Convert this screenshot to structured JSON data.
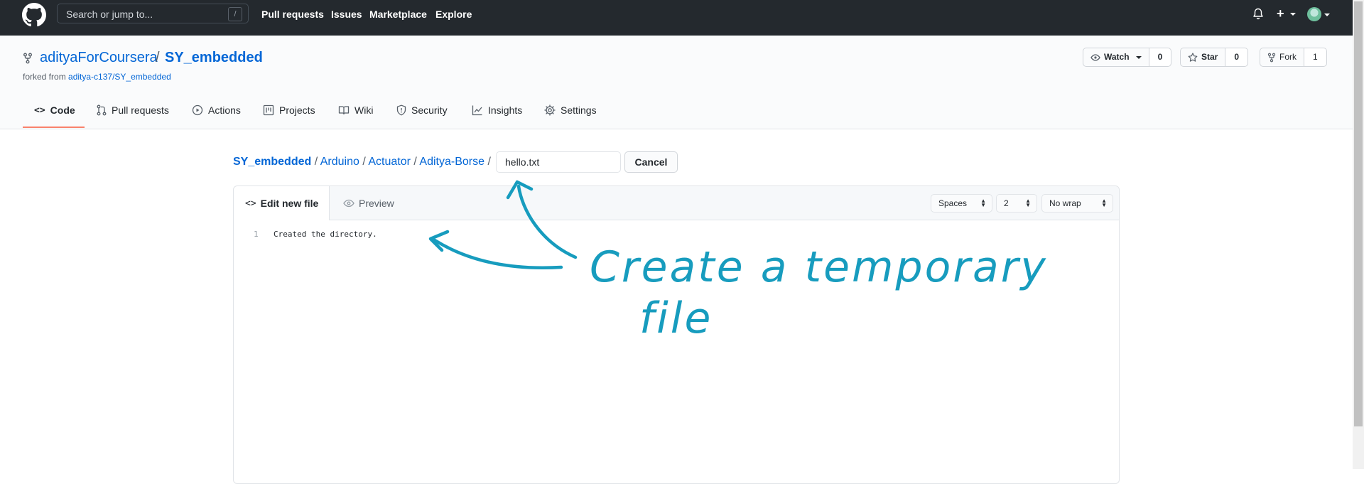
{
  "topbar": {
    "search_placeholder": "Search or jump to...",
    "search_shortcut": "/",
    "nav": [
      "Pull requests",
      "Issues",
      "Marketplace",
      "Explore"
    ]
  },
  "repo": {
    "owner": "adityaForCoursera",
    "separator": "/",
    "name": "SY_embedded",
    "forked_label": "forked from",
    "forked_from": "aditya-c137/SY_embedded"
  },
  "actions": {
    "watch_label": "Watch",
    "watch_count": "0",
    "star_label": "Star",
    "star_count": "0",
    "fork_label": "Fork",
    "fork_count": "1"
  },
  "tabs": [
    "Code",
    "Pull requests",
    "Actions",
    "Projects",
    "Wiki",
    "Security",
    "Insights",
    "Settings"
  ],
  "breadcrumb": {
    "root": "SY_embedded",
    "parts": [
      "Arduino",
      "Actuator",
      "Aditya-Borse"
    ],
    "sep": "/"
  },
  "filename_value": "hello.txt",
  "cancel_label": "Cancel",
  "editor": {
    "tab_edit": "Edit new file",
    "tab_preview": "Preview",
    "indent_mode": "Spaces",
    "indent_size": "2",
    "wrap_mode": "No wrap",
    "line_number": "1",
    "code_line": "Created the directory."
  },
  "annotation": {
    "line1": "Create a temporary",
    "line2": "file",
    "color": "#179cbe"
  },
  "colors": {
    "topbar": "#24292e",
    "link": "#0366d6",
    "active_tab": "#f9826c"
  }
}
